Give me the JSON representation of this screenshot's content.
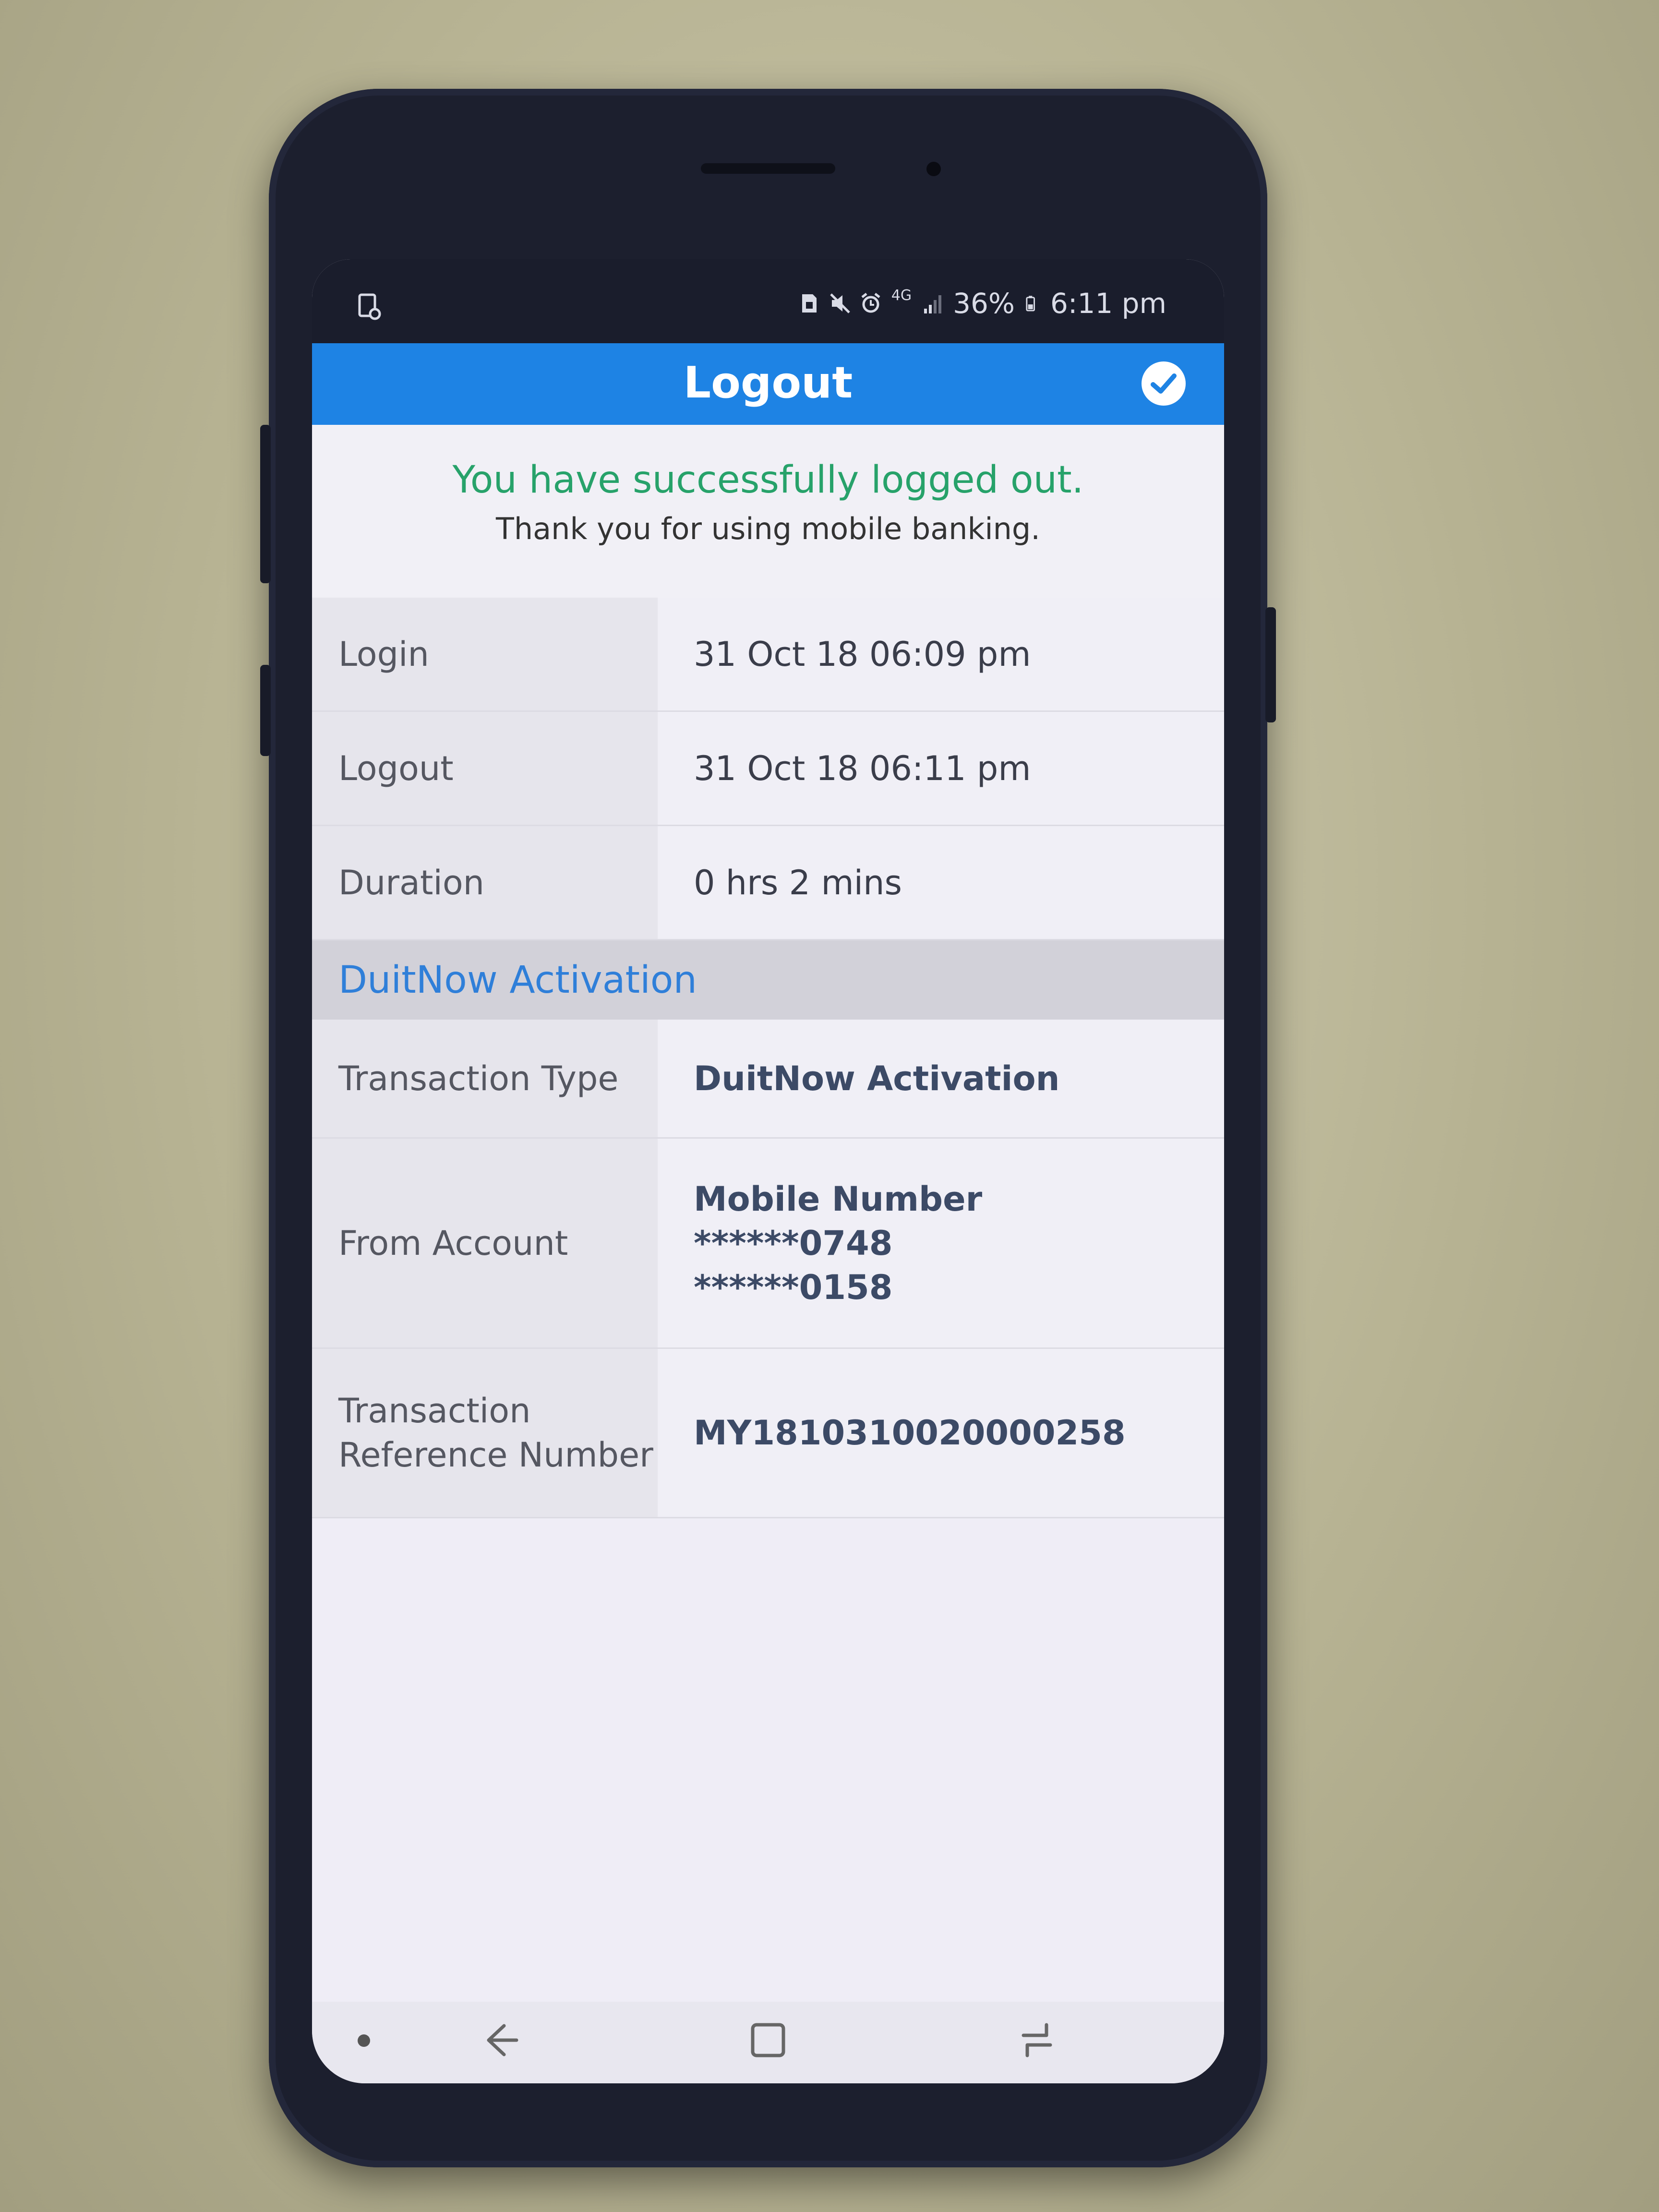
{
  "status_bar": {
    "battery_percent": "36%",
    "time": "6:11 pm",
    "network": "4G",
    "icons": [
      "screenshot-icon",
      "sim-icon",
      "mute-icon",
      "alarm-icon",
      "signal-icon",
      "battery-icon"
    ]
  },
  "header": {
    "title": "Logout",
    "action_icon": "check-circle-icon"
  },
  "message": {
    "title": "You have successfully logged out.",
    "subtitle": "Thank you for using mobile banking."
  },
  "session": {
    "login_label": "Login",
    "login_value": "31 Oct 18 06:09 pm",
    "logout_label": "Logout",
    "logout_value": "31 Oct 18 06:11 pm",
    "duration_label": "Duration",
    "duration_value": "0 hrs 2 mins"
  },
  "section": {
    "title": "DuitNow Activation"
  },
  "transaction": {
    "type_label": "Transaction Type",
    "type_value": "DuitNow Activation",
    "from_label": "From Account",
    "from_lines": [
      "Mobile Number",
      "******0748",
      "******0158"
    ],
    "ref_label_line1": "Transaction",
    "ref_label_line2": "Reference Number",
    "ref_value": "MY1810310020000258"
  },
  "colors": {
    "header_bg": "#1e83e4",
    "success_text": "#27a26a",
    "section_text": "#2f7fd9"
  },
  "navbar": {
    "icons": [
      "nav-dot-icon",
      "back-icon",
      "home-icon",
      "recents-icon"
    ]
  }
}
